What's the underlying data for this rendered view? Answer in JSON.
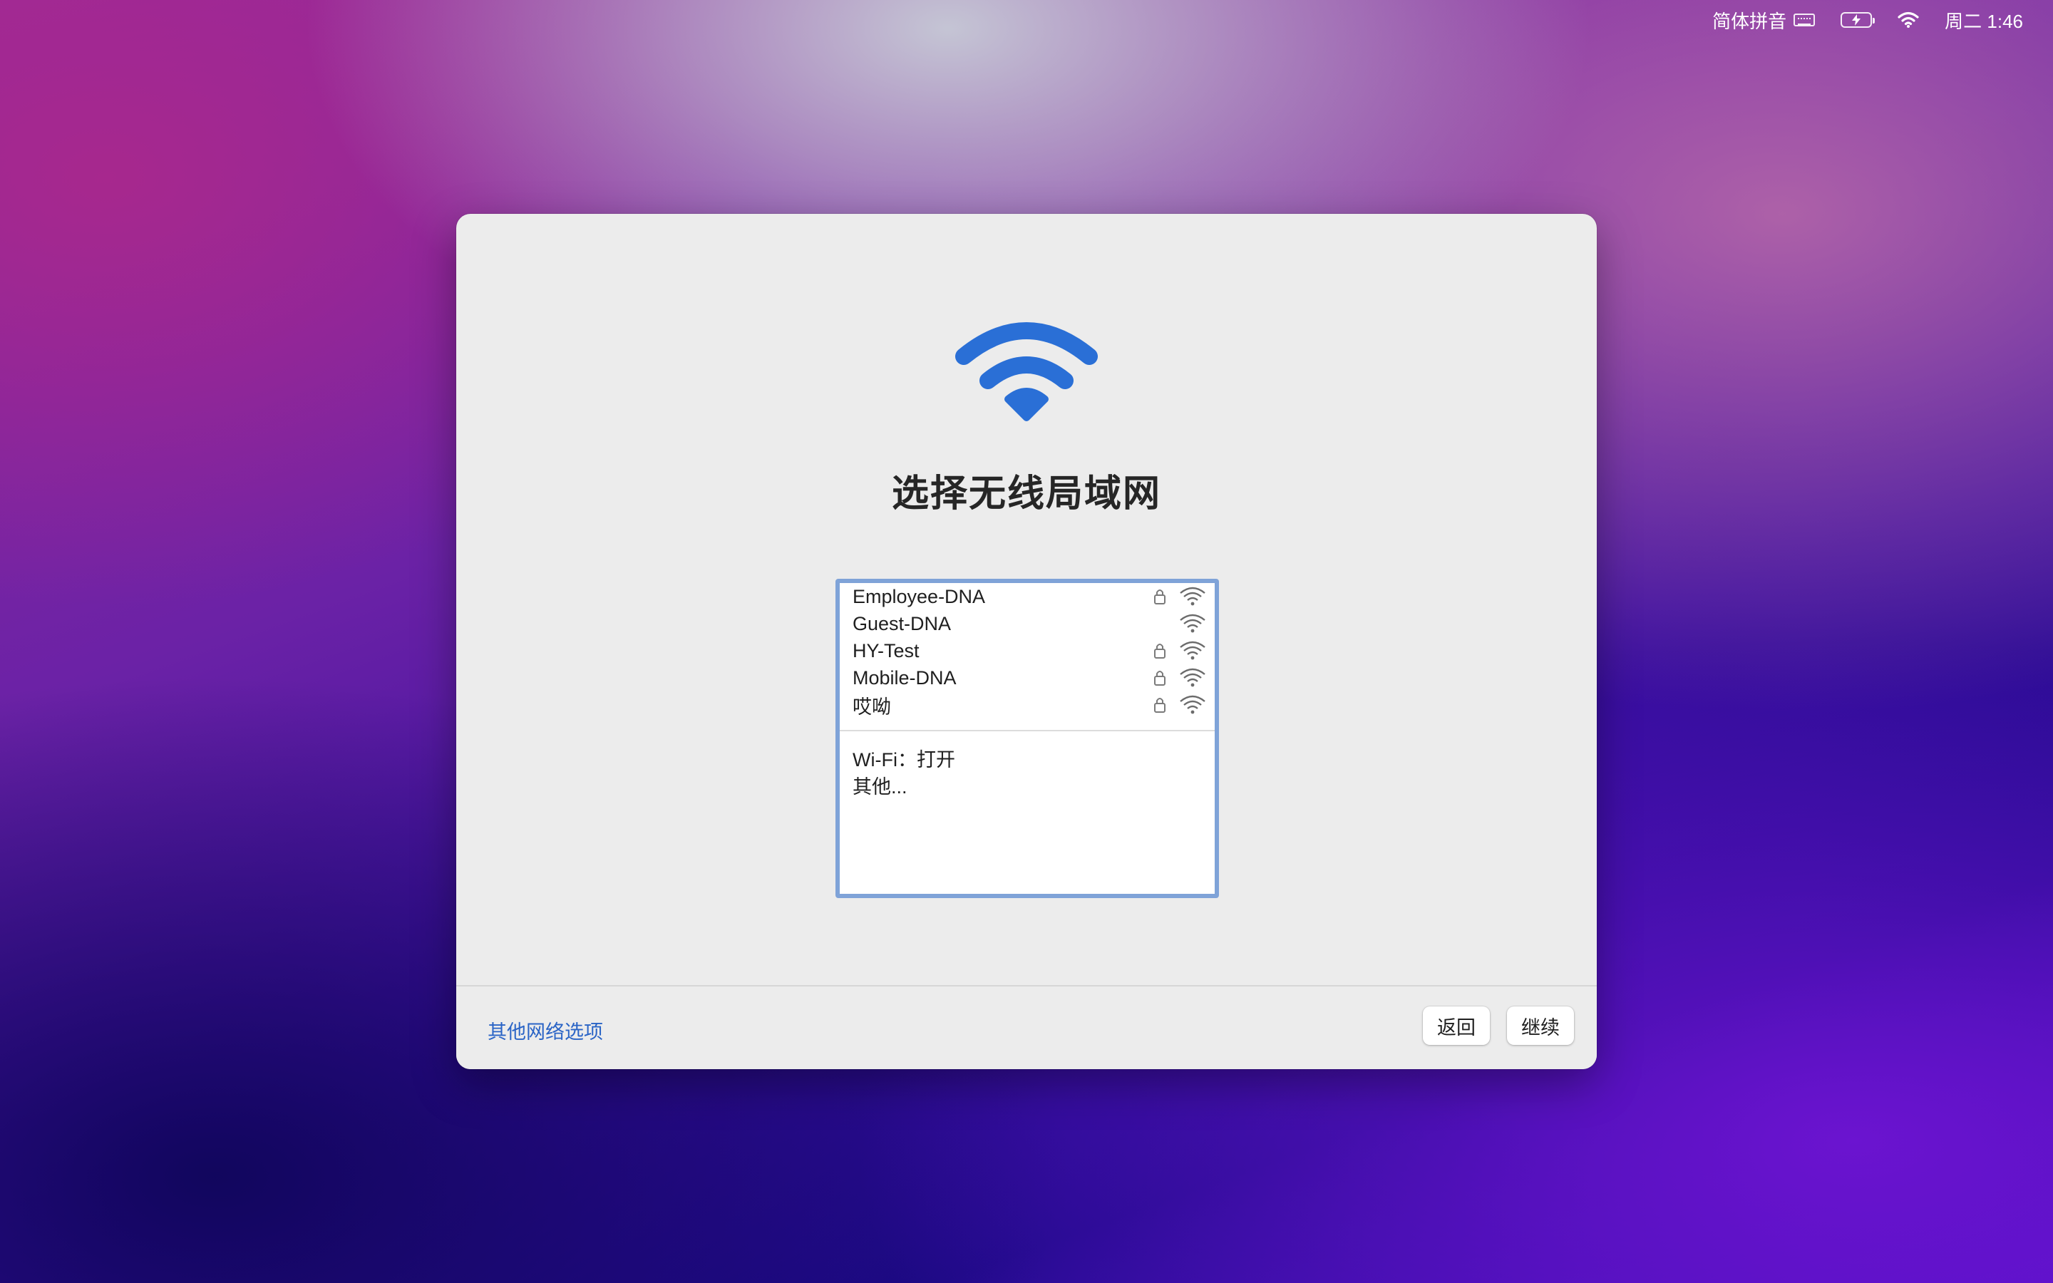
{
  "menubar": {
    "input_method": "简体拼音",
    "input_method_icon": "keyboard-icon",
    "battery_icon": "battery-charging-icon",
    "wifi_icon": "wifi-icon",
    "clock": "周二 1:46"
  },
  "dialog": {
    "hero_icon": "wifi-icon",
    "hero_color": "#2a6fd6",
    "title": "选择无线局域网",
    "networks": [
      {
        "name": "Employee-DNA",
        "locked": true
      },
      {
        "name": "Guest-DNA",
        "locked": false
      },
      {
        "name": "HY-Test",
        "locked": true
      },
      {
        "name": "Mobile-DNA",
        "locked": true
      },
      {
        "name": "哎呦",
        "locked": true
      }
    ],
    "options": [
      {
        "label": "Wi-Fi：打开"
      },
      {
        "label": "其他..."
      }
    ],
    "footer": {
      "other_network_options": "其他网络选项",
      "back": "返回",
      "continue": "继续"
    }
  },
  "colors": {
    "accent": "#2a64c6",
    "list_border": "#7fa3d8"
  }
}
